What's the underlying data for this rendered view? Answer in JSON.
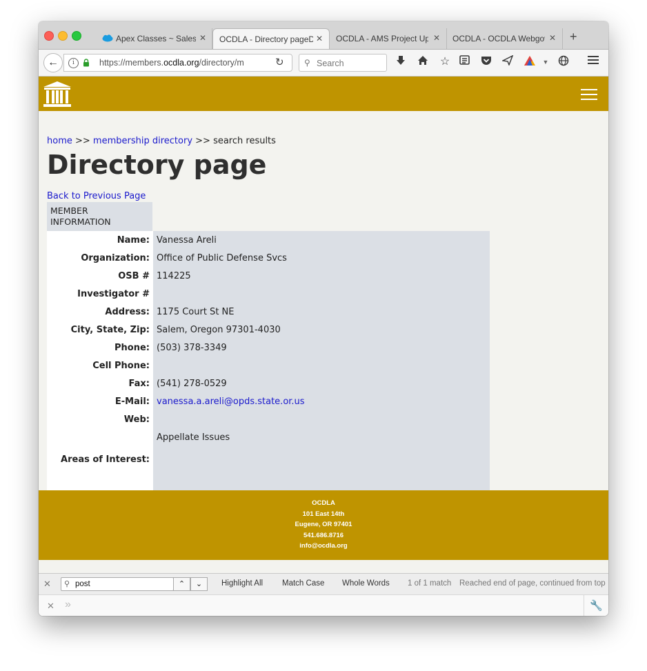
{
  "browser": {
    "tabs": [
      {
        "label": "Apex Classes ~ Salesf",
        "close": "✕"
      },
      {
        "label": "OCDLA - Directory pageD",
        "close": "✕"
      },
      {
        "label": "OCDLA - AMS Project Upd",
        "close": "✕"
      },
      {
        "label": "OCDLA - OCDLA Webgov",
        "close": "✕"
      }
    ],
    "new_tab": "+",
    "url_prefix": "https://members.",
    "url_domain": "ocdla.org",
    "url_path": "/directory/m",
    "search_placeholder": "Search"
  },
  "breadcrumb": {
    "home": "home",
    "sep1": " >> ",
    "directory": "membership directory",
    "sep2": " >> search results"
  },
  "page_title": "Directory page",
  "back_link": "Back to Previous Page",
  "member_info_header": "MEMBER INFORMATION",
  "member": {
    "name_label": "Name:",
    "name": "Vanessa Areli",
    "org_label": "Organization:",
    "org": "Office of Public Defense Svcs",
    "osb_label": "OSB #",
    "osb": "114225",
    "investigator_label": "Investigator #",
    "investigator": "",
    "address_label": "Address:",
    "address": "1175 Court St NE",
    "city_label": "City, State, Zip:",
    "city": "Salem, Oregon 97301-4030",
    "phone_label": "Phone:",
    "phone": "(503) 378-3349",
    "cell_label": "Cell Phone:",
    "cell": "",
    "fax_label": "Fax:",
    "fax": "(541) 278-0529",
    "email_label": "E-Mail:",
    "email": "vanessa.a.areli@opds.state.or.us",
    "web_label": "Web:",
    "web": "",
    "interest_value": "Appellate Issues",
    "interest_label": "Areas of Interest:"
  },
  "footer": {
    "org": "OCDLA",
    "street": "101 East 14th",
    "city": "Eugene, OR 97401",
    "phone": "541.686.8716",
    "email": "info@ocdla.org"
  },
  "findbar": {
    "query": "post",
    "highlight_all": "Highlight All",
    "match_case": "Match Case",
    "whole_words": "Whole Words",
    "match_count": "1 of 1 match",
    "status": "Reached end of page, continued from top"
  },
  "colors": {
    "header_gold": "#bf9400",
    "link_blue": "#1a19cc",
    "panel_gray": "#dbdfe5"
  }
}
